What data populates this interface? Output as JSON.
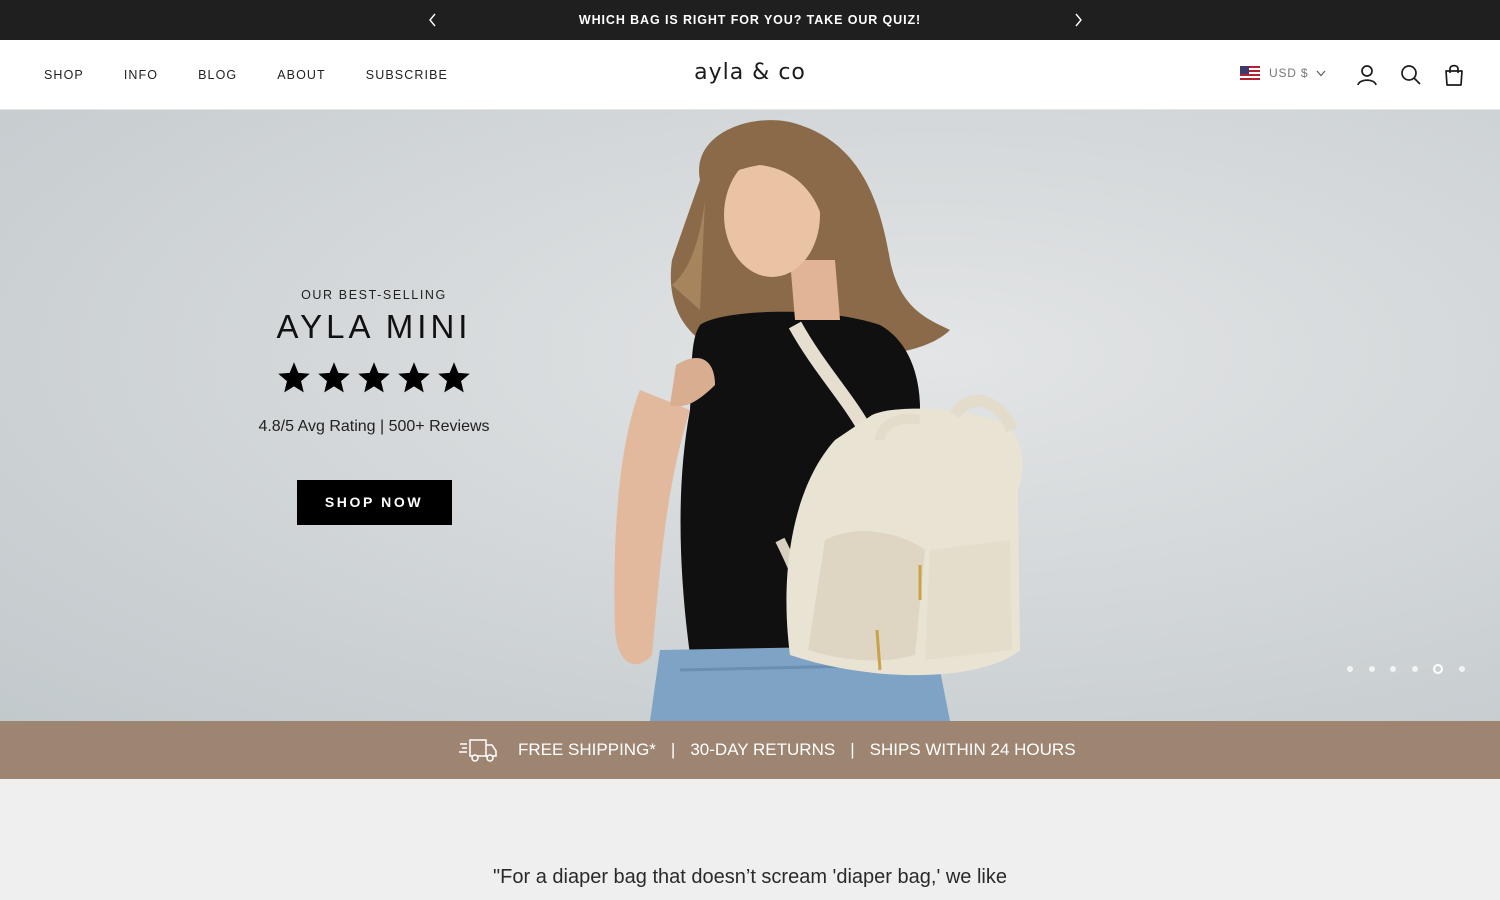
{
  "announcement": {
    "text": "WHICH BAG IS RIGHT FOR YOU? TAKE OUR QUIZ!",
    "prev_icon": "chevron-left-icon",
    "next_icon": "chevron-right-icon"
  },
  "header": {
    "nav": [
      "SHOP",
      "INFO",
      "BLOG",
      "ABOUT",
      "SUBSCRIBE"
    ],
    "logo": "ayla & co",
    "currency": "USD $",
    "icons": [
      "us-flag-icon",
      "chevron-down-icon",
      "account-icon",
      "search-icon",
      "cart-bag-icon"
    ]
  },
  "hero": {
    "eyebrow": "OUR BEST-SELLING",
    "title": "AYLA MINI",
    "stars": 5,
    "rating_text": "4.8/5 Avg Rating | 500+ Reviews",
    "cta": "SHOP NOW",
    "slides": 6,
    "active_slide": 5
  },
  "perks": {
    "icon": "delivery-truck-icon",
    "items": [
      "FREE SHIPPING*",
      "30-DAY RETURNS",
      "SHIPS WITHIN 24 HOURS"
    ],
    "separator": "|"
  },
  "quote": {
    "text": "\"For a diaper bag that doesn’t scream 'diaper bag,' we like"
  },
  "colors": {
    "announcement_bg": "#1f1f1f",
    "perks_bg": "#9e8571",
    "cta_bg": "#000000",
    "page_bg": "#efefef"
  }
}
